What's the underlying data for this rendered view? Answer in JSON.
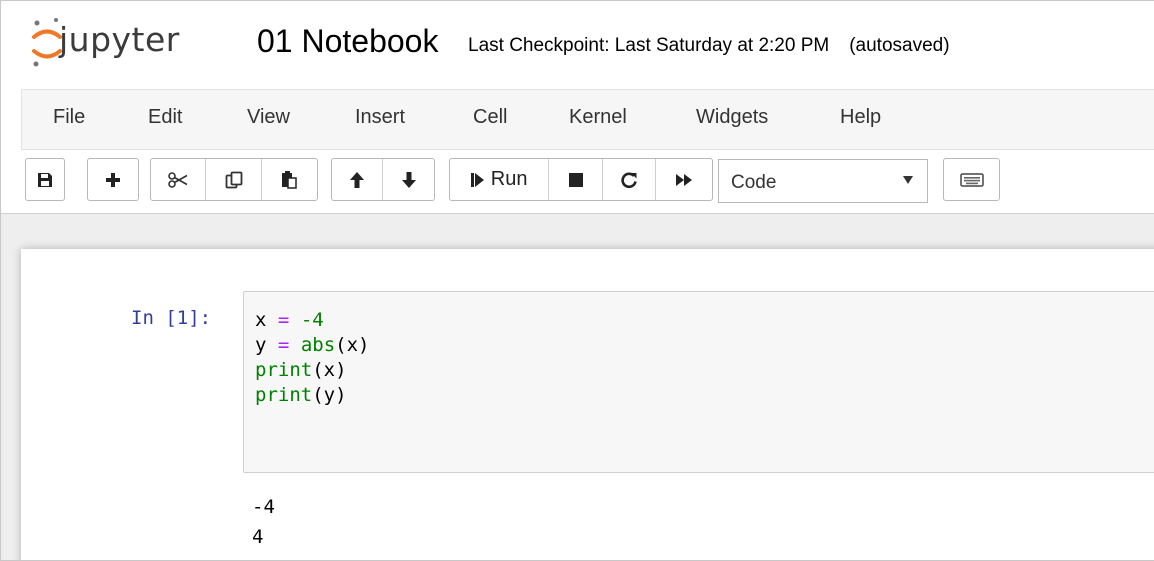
{
  "header": {
    "logo_text": "jupyter",
    "notebook_name": "01 Notebook",
    "checkpoint": "Last Checkpoint: Last Saturday at 2:20 PM",
    "autosave_status": "(autosaved)"
  },
  "menu": {
    "items": [
      "File",
      "Edit",
      "View",
      "Insert",
      "Cell",
      "Kernel",
      "Widgets",
      "Help"
    ]
  },
  "toolbar": {
    "run_label": "Run",
    "cell_type": "Code",
    "cell_type_options": [
      "Code"
    ]
  },
  "cell": {
    "prompt": "In [1]:",
    "code_lines": [
      [
        "x",
        " ",
        "=",
        " ",
        "-4"
      ],
      [
        "y",
        " ",
        "=",
        " ",
        "abs",
        "(x)"
      ],
      [
        "print",
        "(x)"
      ],
      [
        "print",
        "(y)"
      ]
    ],
    "output_lines": [
      "-4",
      "4"
    ]
  },
  "colors": {
    "prompt": "#303f9f",
    "operator": "#aa22ff",
    "number": "#008000",
    "builtin": "#008000",
    "logo_orange": "#f37726"
  }
}
